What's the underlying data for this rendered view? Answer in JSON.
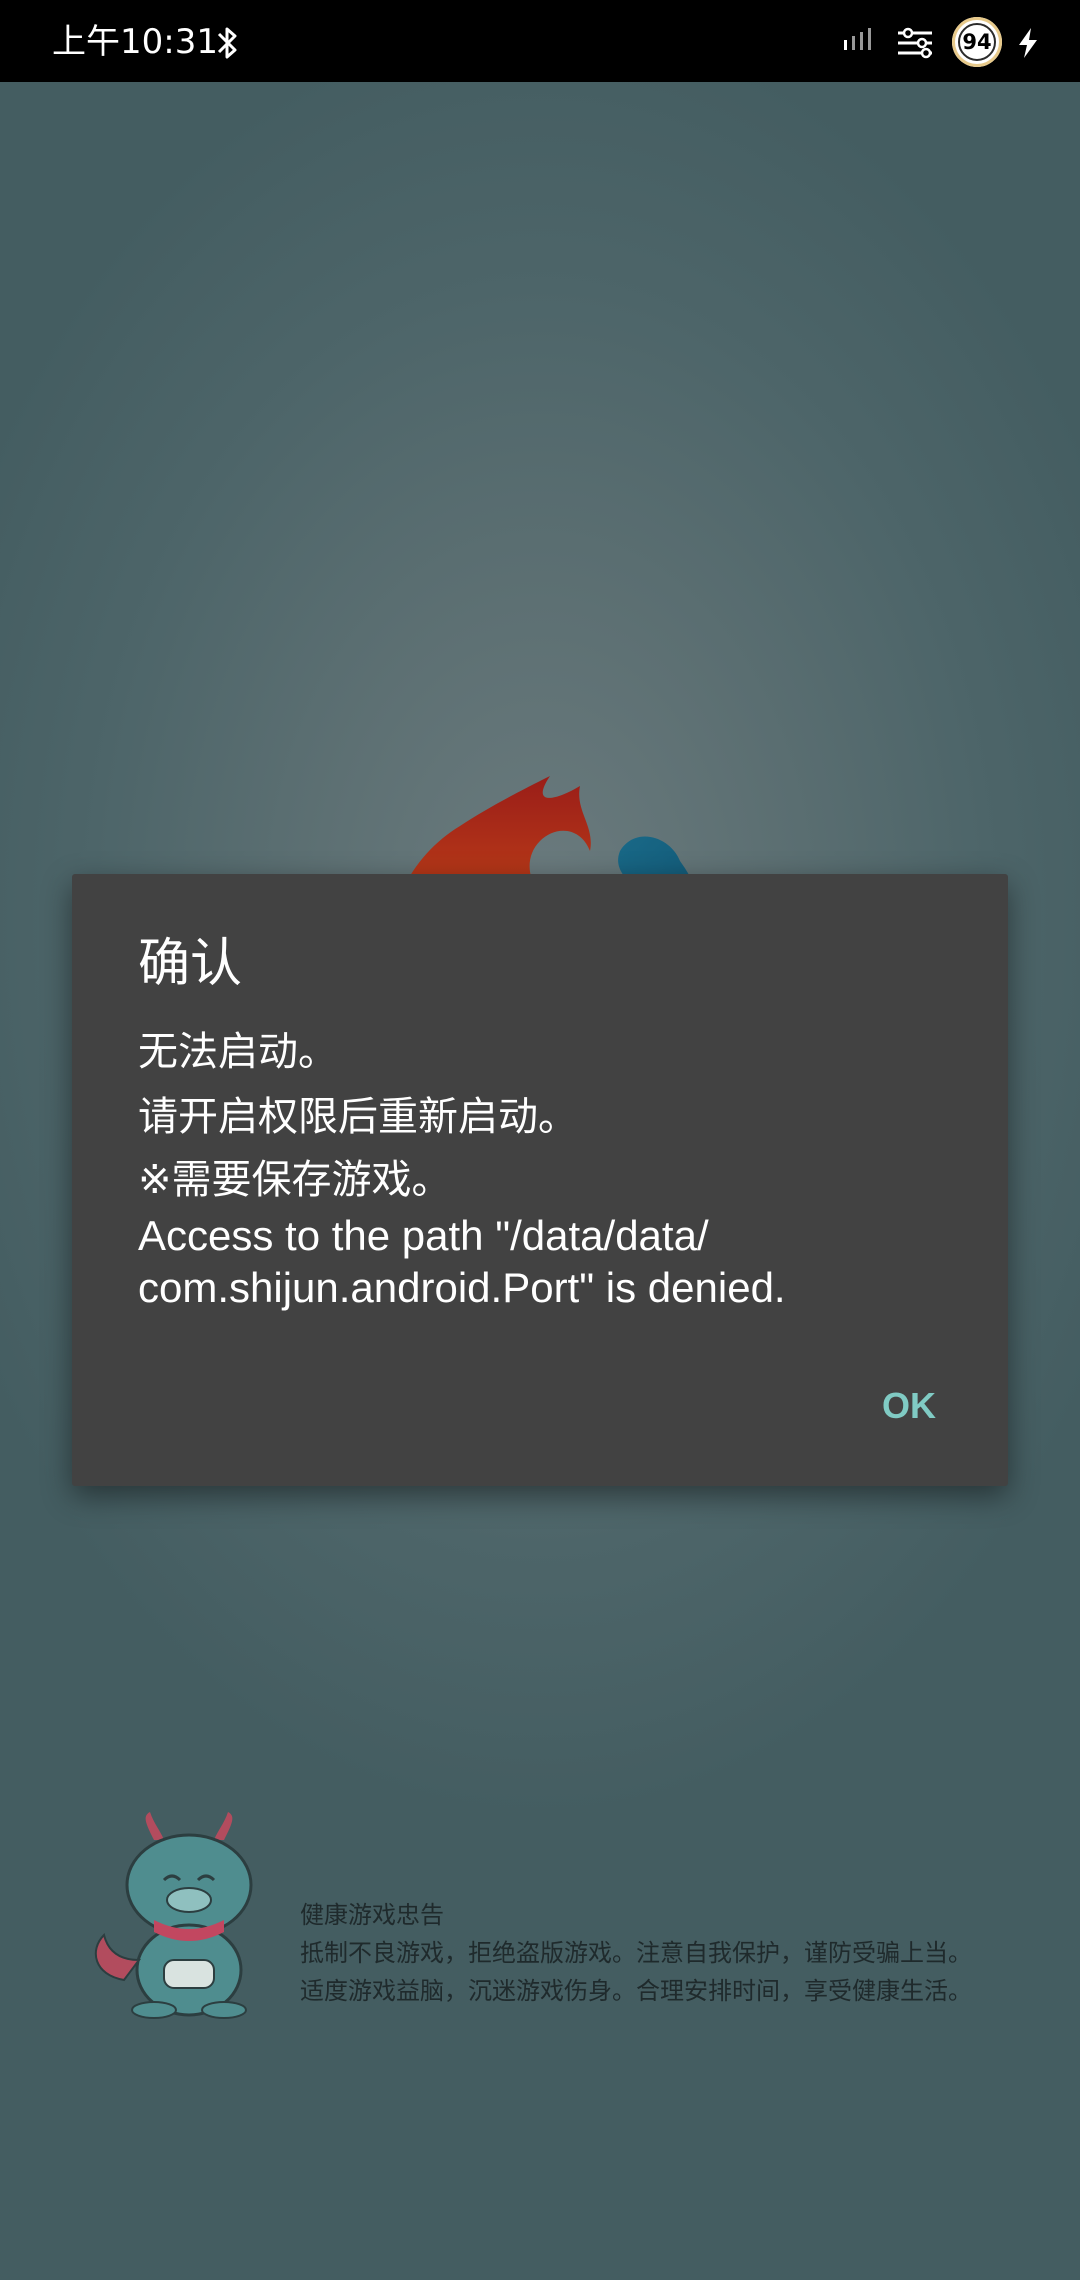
{
  "status_bar": {
    "time": "上午10:31",
    "battery_level": "94",
    "icons": [
      "bluetooth-icon",
      "signal-icon",
      "settings-sliders-icon",
      "battery-icon",
      "charging-icon"
    ]
  },
  "dialog": {
    "title": "确认",
    "message_lines": [
      "无法启动。",
      "请开启权限后重新启动。",
      "※需要保存游戏。"
    ],
    "error_line_1": "Access to the path \"/data/data/",
    "error_line_2": "com.shijun.android.Port\" is denied.",
    "ok_label": "OK",
    "accent_color": "#80cbc4"
  },
  "health_notice": {
    "title": "健康游戏忠告",
    "line1": "抵制不良游戏，拒绝盗版游戏。注意自我保护，谨防受骗上当。",
    "line2": "适度游戏益脑，沉迷游戏伤身。合理安排时间，享受健康生活。"
  }
}
